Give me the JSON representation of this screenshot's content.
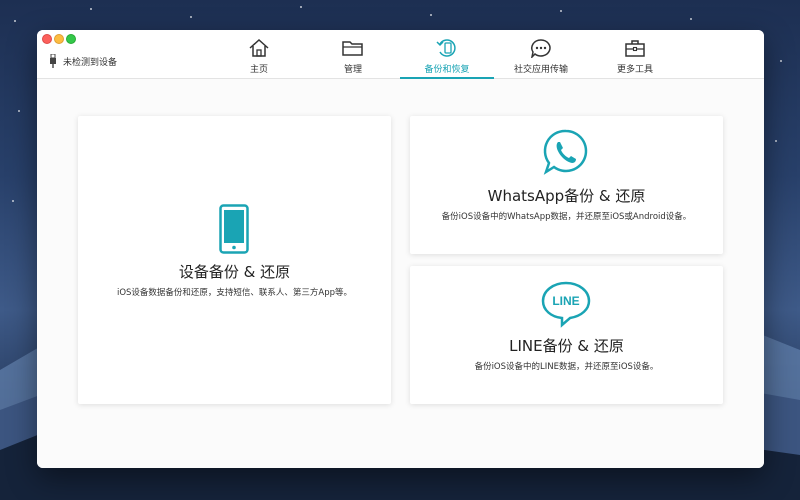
{
  "titlebar": {
    "device_status": "未检测到设备"
  },
  "nav": {
    "tabs": [
      {
        "label": "主页",
        "icon": "home-icon"
      },
      {
        "label": "管理",
        "icon": "folder-icon"
      },
      {
        "label": "备份和恢复",
        "icon": "backup-restore-icon",
        "active": true
      },
      {
        "label": "社交应用传输",
        "icon": "chat-bubble-icon"
      },
      {
        "label": "更多工具",
        "icon": "toolbox-icon"
      }
    ]
  },
  "cards": {
    "device_backup": {
      "title": "设备备份 & 还原",
      "description": "iOS设备数据备份和还原，支持短信、联系人、第三方App等。",
      "icon": "phone-icon"
    },
    "whatsapp": {
      "title": "WhatsApp备份 & 还原",
      "description": "备份iOS设备中的WhatsApp数据，并还原至iOS或Android设备。",
      "icon": "whatsapp-icon"
    },
    "line": {
      "title": "LINE备份 & 还原",
      "description": "备份iOS设备中的LINE数据，并还原至iOS设备。",
      "icon": "line-icon",
      "icon_text": "LINE"
    }
  },
  "colors": {
    "accent": "#1aa4b4",
    "text": "#333333",
    "traffic_close": "#fc605c",
    "traffic_min": "#fdbc40",
    "traffic_max": "#34c84a"
  }
}
